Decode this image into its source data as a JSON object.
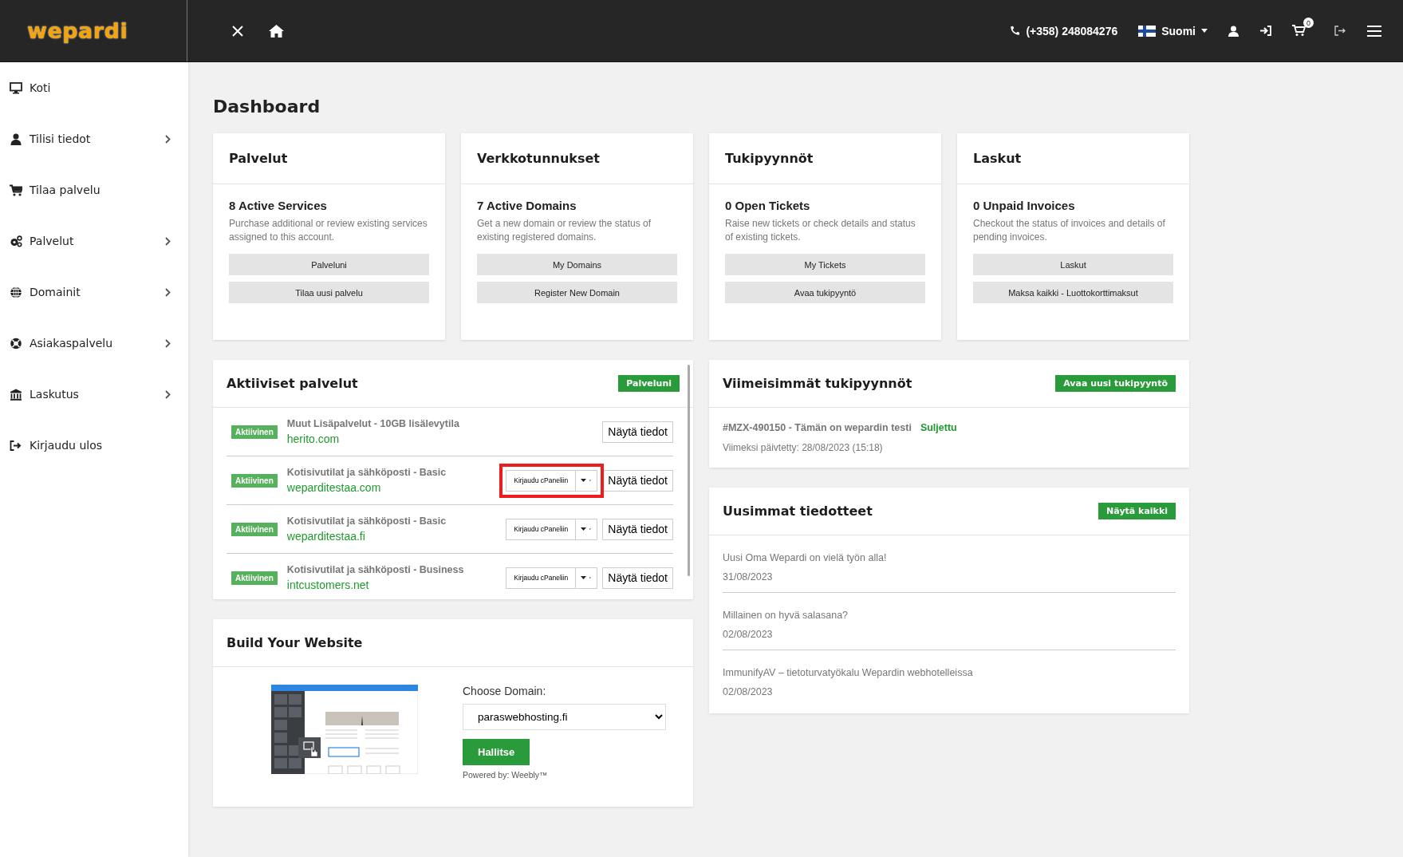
{
  "header": {
    "logo": "wepardi",
    "phone": "(+358) 248084276",
    "language": "Suomi",
    "cart_count": "0"
  },
  "sidebar": {
    "items": [
      {
        "label": "Koti",
        "expandable": false
      },
      {
        "label": "Tilisi tiedot",
        "expandable": true
      },
      {
        "label": "Tilaa palvelu",
        "expandable": false
      },
      {
        "label": "Palvelut",
        "expandable": true
      },
      {
        "label": "Domainit",
        "expandable": true
      },
      {
        "label": "Asiakaspalvelu",
        "expandable": true
      },
      {
        "label": "Laskutus",
        "expandable": true
      },
      {
        "label": "Kirjaudu ulos",
        "expandable": false
      }
    ]
  },
  "page_title": "Dashboard",
  "summary_cards": [
    {
      "title": "Palvelut",
      "count": "8 Active Services",
      "description": "Purchase additional or review existing services assigned to this account.",
      "buttons": [
        "Palveluni",
        "Tilaa uusi palvelu"
      ]
    },
    {
      "title": "Verkkotunnukset",
      "count": "7 Active Domains",
      "description": "Get a new domain or review the status of existing registered domains.",
      "buttons": [
        "My Domains",
        "Register New Domain"
      ]
    },
    {
      "title": "Tukipyynnöt",
      "count": "0 Open Tickets",
      "description": "Raise new tickets or check details and status of existing tickets.",
      "buttons": [
        "My Tickets",
        "Avaa tukipyyntö"
      ]
    },
    {
      "title": "Laskut",
      "count": "0 Unpaid Invoices",
      "description": "Checkout the status of invoices and details of pending invoices.",
      "buttons": [
        "Laskut",
        "Maksa kaikki - Luottokorttimaksut"
      ]
    }
  ],
  "active_services": {
    "title": "Aktiiviset palvelut",
    "button": "Palveluni",
    "rows": [
      {
        "status": "Aktiivinen",
        "product": "Muut Lisäpalvelut - 10GB lisälevytila",
        "domain": "herito.com",
        "details": "Näytä tiedot",
        "highlighted": false
      },
      {
        "status": "Aktiivinen",
        "product": "Kotisivutilat ja sähköposti - Basic",
        "domain": "weparditestaa.com",
        "login": "Kirjaudu cPaneliin",
        "details": "Näytä tiedot",
        "highlighted": true
      },
      {
        "status": "Aktiivinen",
        "product": "Kotisivutilat ja sähköposti - Basic",
        "domain": "weparditestaa.fi",
        "login": "Kirjaudu cPaneliin",
        "details": "Näytä tiedot",
        "highlighted": false
      },
      {
        "status": "Aktiivinen",
        "product": "Kotisivutilat ja sähköposti - Business",
        "domain": "intcustomers.net",
        "login": "Kirjaudu cPaneliin",
        "details": "Näytä tiedot",
        "highlighted": false
      }
    ]
  },
  "recent_tickets": {
    "title": "Viimeisimmät tukipyynnöt",
    "button": "Avaa uusi tukipyyntö",
    "tickets": [
      {
        "subject": "#MZX-490150 - Tämän on wepardin testi",
        "status": "Suljettu",
        "updated": "Viimeksi päivtetty: 28/08/2023 (15:18)"
      }
    ]
  },
  "announcements": {
    "title": "Uusimmat tiedotteet",
    "button": "Näytä kaikki",
    "items": [
      {
        "title": "Uusi Oma Wepardi on vielä työn alla!",
        "date": "31/08/2023"
      },
      {
        "title": "Millainen on hyvä salasana?",
        "date": "02/08/2023"
      },
      {
        "title": "ImmunifyAV – tietoturvatyökalu Wepardin webhotelleissa",
        "date": "02/08/2023"
      }
    ]
  },
  "website_builder": {
    "title": "Build Your Website",
    "domain_label": "Choose Domain:",
    "domain": "paraswebhosting.fi",
    "button": "Hallitse",
    "powered_by": "Powered by: Weebly™"
  }
}
